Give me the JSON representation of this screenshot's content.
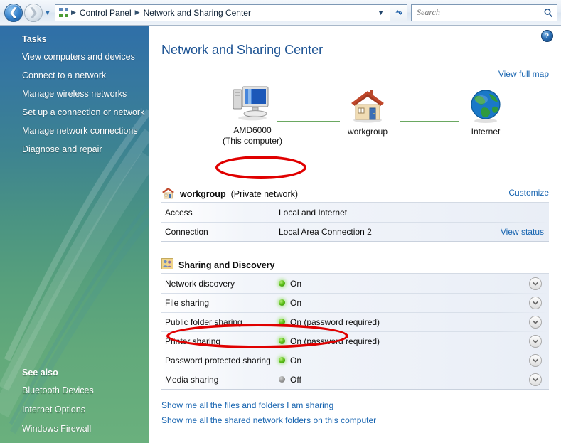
{
  "window": {
    "nav": {
      "back_icon": "back-arrow-icon",
      "forward_icon": "forward-arrow-icon",
      "history_icon": "chevron-down-icon",
      "address_icon": "network-icon",
      "breadcrumbs": [
        "Control Panel",
        "Network and Sharing Center"
      ],
      "address_dropdown_icon": "chevron-down-icon",
      "refresh_icon": "refresh-icon",
      "refresh_glyph": "↯"
    },
    "search": {
      "placeholder": "Search",
      "value": "",
      "icon": "search-icon"
    },
    "help": {
      "icon": "help-icon",
      "glyph": "?"
    }
  },
  "sidebar": {
    "tasks_heading": "Tasks",
    "tasks": [
      {
        "label": "View computers and devices"
      },
      {
        "label": "Connect to a network"
      },
      {
        "label": "Manage wireless networks"
      },
      {
        "label": "Set up a connection or network"
      },
      {
        "label": "Manage network connections"
      },
      {
        "label": "Diagnose and repair"
      }
    ],
    "see_also_heading": "See also",
    "see_also": [
      {
        "label": "Bluetooth Devices"
      },
      {
        "label": "Internet Options"
      },
      {
        "label": "Windows Firewall"
      }
    ]
  },
  "main": {
    "page_title": "Network and Sharing Center",
    "view_full_map": "View full map",
    "network_map": {
      "nodes": [
        {
          "icon": "computer-icon",
          "name": "AMD6000",
          "sub": "(This computer)"
        },
        {
          "icon": "house-icon",
          "name": "workgroup",
          "sub": ""
        },
        {
          "icon": "globe-icon",
          "name": "Internet",
          "sub": ""
        }
      ],
      "link_color": "#6aa861"
    },
    "workgroup_section": {
      "icon": "house-icon",
      "title": "workgroup",
      "subtitle": "(Private network)",
      "customize_link": "Customize",
      "rows": [
        {
          "label": "Access",
          "value": "Local and Internet",
          "action": ""
        },
        {
          "label": "Connection",
          "value": "Local Area Connection 2",
          "action": "View status"
        }
      ]
    },
    "sharing_section": {
      "icon": "people-sharing-icon",
      "title": "Sharing and Discovery",
      "expander_icon": "chevron-down-icon",
      "rows": [
        {
          "label": "Network discovery",
          "state": "on",
          "status": "On"
        },
        {
          "label": "File sharing",
          "state": "on",
          "status": "On"
        },
        {
          "label": "Public folder sharing",
          "state": "on",
          "status": "On (password required)"
        },
        {
          "label": "Printer sharing",
          "state": "on",
          "status": "On (password required)"
        },
        {
          "label": "Password protected sharing",
          "state": "on",
          "status": "On"
        },
        {
          "label": "Media sharing",
          "state": "off",
          "status": "Off"
        }
      ]
    },
    "bottom_links": [
      {
        "label": "Show me all the files and folders I am sharing"
      },
      {
        "label": "Show me all the shared network folders on this computer"
      }
    ]
  },
  "annotations": {
    "color": "#e00000",
    "items": [
      {
        "name": "annotation-private-network",
        "target": "(Private network)"
      },
      {
        "name": "annotation-password-sharing",
        "target": "Password protected sharing On"
      }
    ]
  }
}
